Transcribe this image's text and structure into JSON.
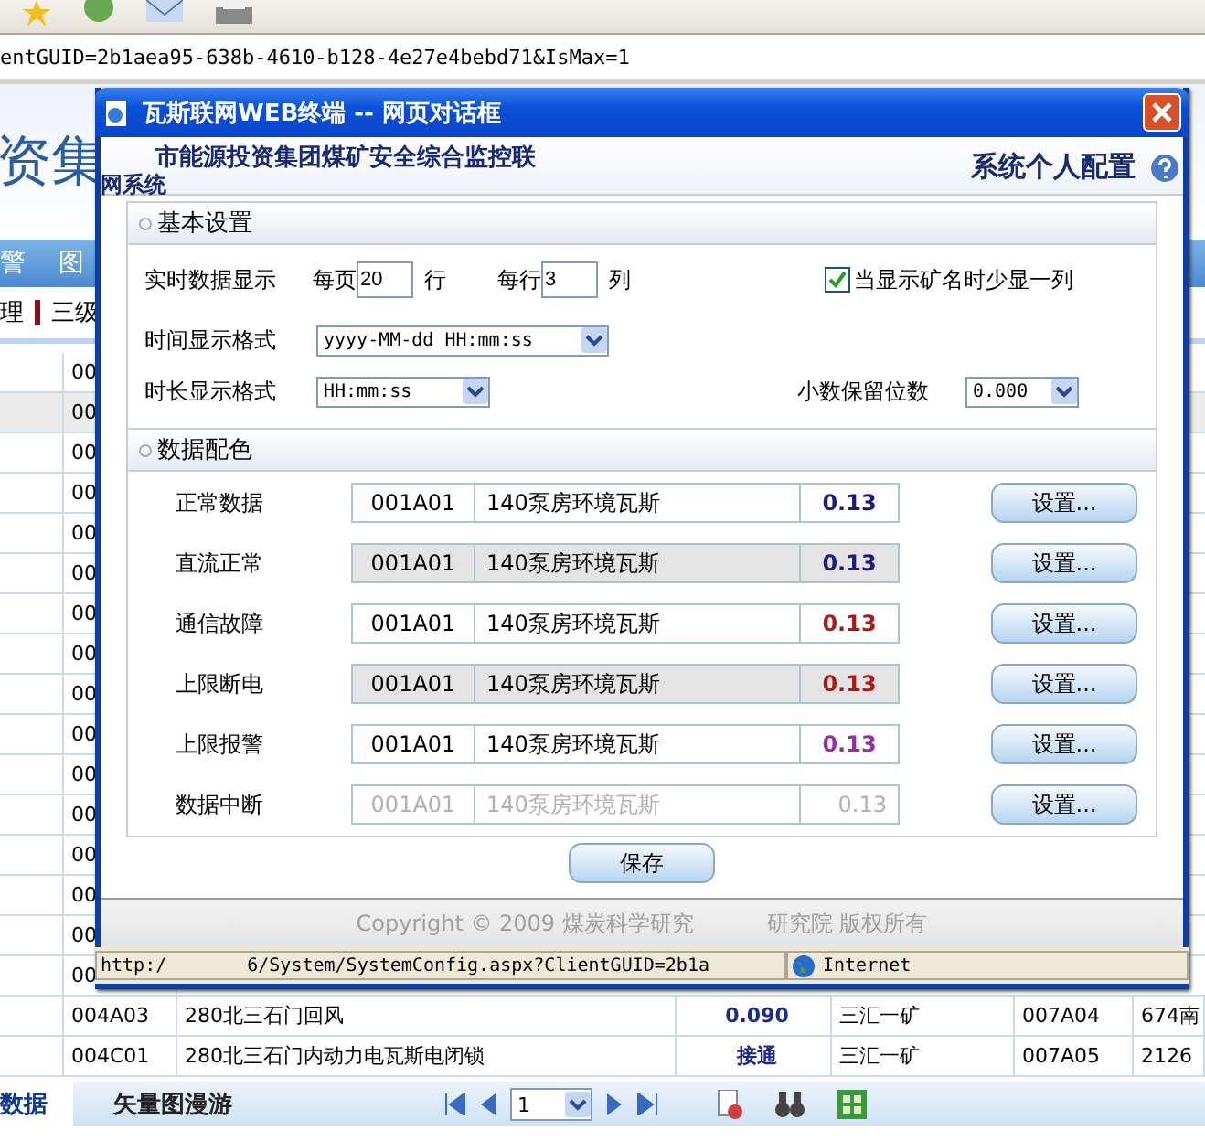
{
  "browser": {
    "address": "entGUID=2b1aea95-638b-4610-b128-4e27e4bebd71&IsMax=1"
  },
  "page": {
    "banner": "资集",
    "nav": [
      "警",
      "图"
    ],
    "breadcrumb": [
      "理",
      "三级"
    ],
    "table": {
      "hidden_rows": [
        {
          "code": "00",
          "selected": false
        },
        {
          "code": "00",
          "selected": true
        },
        {
          "code": "00",
          "selected": false
        },
        {
          "code": "00",
          "selected": false
        },
        {
          "code": "00",
          "selected": false
        },
        {
          "code": "00",
          "selected": false
        },
        {
          "code": "00",
          "selected": false
        },
        {
          "code": "00",
          "selected": false
        },
        {
          "code": "00",
          "selected": false
        },
        {
          "code": "00",
          "selected": false
        },
        {
          "code": "00",
          "selected": false
        },
        {
          "code": "00",
          "selected": false
        },
        {
          "code": "00",
          "selected": false
        },
        {
          "code": "00",
          "selected": false
        },
        {
          "code": "00",
          "selected": false
        },
        {
          "code": "00",
          "selected": false
        }
      ],
      "rows": [
        {
          "cells": [
            "004A03",
            "280北三石门回风",
            "0.090",
            "三汇一矿",
            "007A04",
            "674南"
          ]
        },
        {
          "cells": [
            "004C01",
            "280北三石门内动力电瓦斯电闭锁",
            "接通",
            "三汇一矿",
            "007A05",
            "2126"
          ]
        }
      ]
    },
    "tabs": [
      {
        "label": "数据",
        "selected": true
      },
      {
        "label": "矢量图漫游",
        "selected": false
      }
    ],
    "pager": {
      "page": "1"
    }
  },
  "dialog": {
    "title": "瓦斯联网WEB终端 -- 网页对话框",
    "header_lines": [
      "市能源投资集团煤矿安全综合监控联",
      "网系统"
    ],
    "heading": "系统个人配置",
    "basic": {
      "title": "基本设置",
      "realtime_label": "实时数据显示",
      "per_page_label": "每页",
      "per_page": "20",
      "rows_unit": "行",
      "per_row_label": "每行",
      "per_row": "3",
      "cols_unit": "列",
      "checkbox": {
        "label": "当显示矿名时少显一列",
        "checked": true
      },
      "time_format": {
        "label": "时间显示格式",
        "value": "yyyy-MM-dd HH:mm:ss"
      },
      "duration_format": {
        "label": "时长显示格式",
        "value": "HH:mm:ss"
      },
      "decimals": {
        "label": "小数保留位数",
        "value": "0.000"
      }
    },
    "colors": {
      "title": "数据配色",
      "rows": [
        {
          "name": "正常数据",
          "code": "001A01",
          "point": "140泵房环境瓦斯",
          "value": "0.13",
          "color": "#1a1a80",
          "shaded": false,
          "disabled": false,
          "button": "设置..."
        },
        {
          "name": "直流正常",
          "code": "001A01",
          "point": "140泵房环境瓦斯",
          "value": "0.13",
          "color": "#1a1a80",
          "shaded": true,
          "disabled": false,
          "button": "设置..."
        },
        {
          "name": "通信故障",
          "code": "001A01",
          "point": "140泵房环境瓦斯",
          "value": "0.13",
          "color": "#b01818",
          "shaded": false,
          "disabled": false,
          "button": "设置..."
        },
        {
          "name": "上限断电",
          "code": "001A01",
          "point": "140泵房环境瓦斯",
          "value": "0.13",
          "color": "#b01818",
          "shaded": true,
          "disabled": false,
          "button": "设置..."
        },
        {
          "name": "上限报警",
          "code": "001A01",
          "point": "140泵房环境瓦斯",
          "value": "0.13",
          "color": "#9a2aa8",
          "shaded": false,
          "disabled": false,
          "button": "设置..."
        },
        {
          "name": "数据中断",
          "code": "001A01",
          "point": "140泵房环境瓦斯",
          "value": "0.13",
          "color": "#b0b0b0",
          "shaded": false,
          "disabled": true,
          "button": "设置..."
        }
      ]
    },
    "save": "保存",
    "copyright": [
      "Copyright © 2009 煤炭科学研究",
      "研究院 版权所有"
    ],
    "status": {
      "url_start": "http:/",
      "url_end": "6/System/SystemConfig.aspx?ClientGUID=2b1a",
      "zone": "Internet"
    }
  }
}
